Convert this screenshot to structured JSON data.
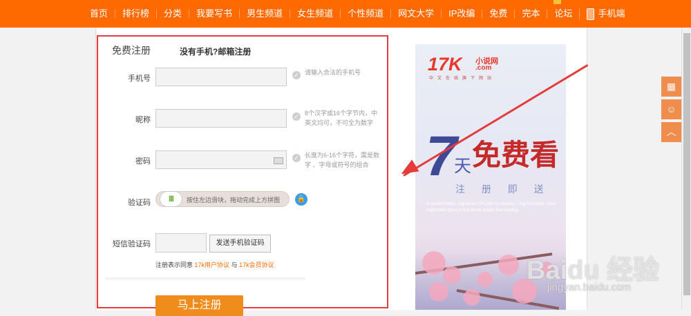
{
  "nav": {
    "items": [
      "首页",
      "排行榜",
      "分类",
      "我要写书",
      "男生频道",
      "女生频道",
      "个性频道",
      "网文大学",
      "IP改编",
      "免费",
      "完本",
      "论坛"
    ],
    "mobile": "手机端"
  },
  "form": {
    "tab_free": "免费注册",
    "tab_email": "没有手机?邮箱注册",
    "phone_label": "手机号",
    "phone_hint": "请输入合法的手机号",
    "nick_label": "昵称",
    "nick_hint": "8个汉字或16个字节内，中英文均可，不可全为数字",
    "pwd_label": "密码",
    "pwd_hint": "长度为6-16个字符，需是数字 、字母或符号的组合",
    "captcha_label": "验证码",
    "slider_text": "按住左边滑块，拖动完成上方拼图",
    "slider_handle": "III",
    "sms_label": "短信验证码",
    "sms_button": "发送手机验证码",
    "agree_prefix": "注册表示同意",
    "agree_link1": "17k用户协议",
    "agree_mid": "与",
    "agree_link2": "17k会员协议",
    "submit": "马上注册"
  },
  "banner": {
    "logo_num": "17K",
    "logo_cn": "小说网",
    "logo_com": ".com",
    "slogan": "中文在线旗下网站",
    "seven": "7",
    "day": "天",
    "free_read": "免费看",
    "subtitle": "注 册 即 送",
    "english": "In ancient times, registered 17K.com for reading 7 day free book, each registration gives to the whole station free reading..."
  },
  "watermark": {
    "brand": "Baidu 经验",
    "url": "jingyan.baidu.com"
  },
  "colors": {
    "nav_bg": "#ff6a00",
    "highlight_border": "#e53b3b",
    "link": "#ff6a00",
    "submit_bg": "#f08c1c"
  },
  "icons": [
    "phone-icon",
    "check-hint-icon",
    "keyboard-icon",
    "lock-icon",
    "qrcode-icon",
    "service-icon",
    "back-to-top-icon"
  ]
}
